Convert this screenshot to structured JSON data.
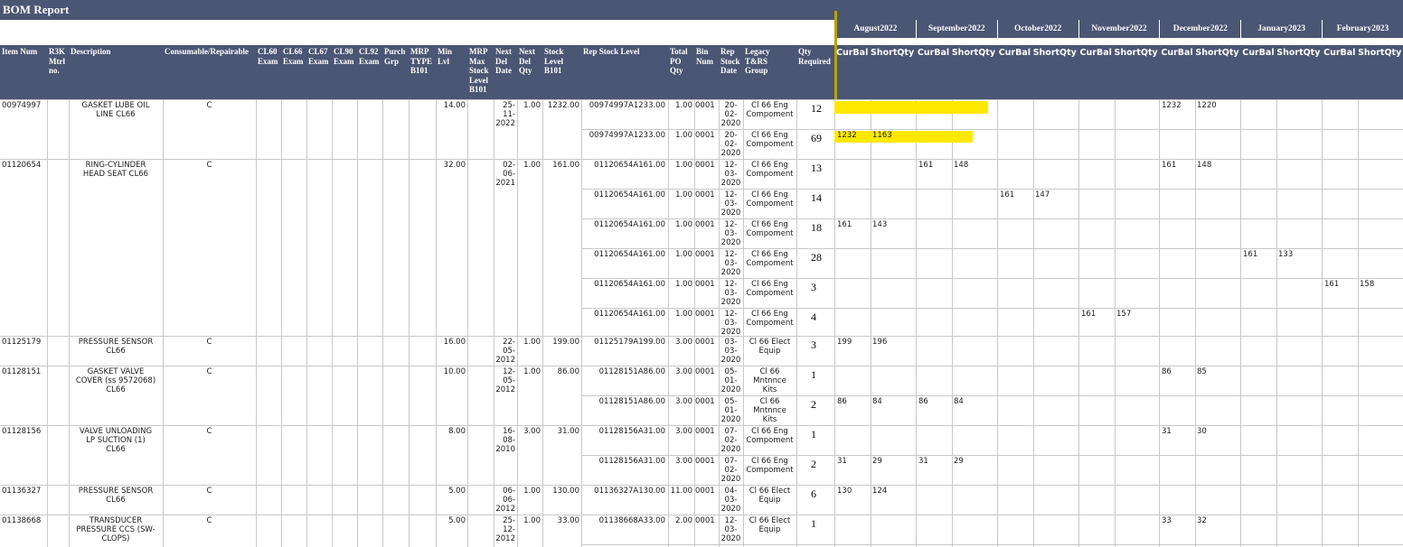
{
  "report_title": "BOM Report",
  "months": [
    "August2022",
    "September2022",
    "October2022",
    "November2022",
    "December2022",
    "January2023",
    "February2023"
  ],
  "headers": {
    "item_num": "Item Num",
    "r3k": [
      "R3K",
      "Mtrl",
      "no."
    ],
    "description": "Description",
    "consumable": "Consumable/Repairable",
    "cl60": [
      "CL60",
      "Exam"
    ],
    "cl66": [
      "CL66",
      "Exam"
    ],
    "cl67": [
      "CL67",
      "Exam"
    ],
    "cl90": [
      "CL90",
      "Exam"
    ],
    "cl92": [
      "CL92",
      "Exam"
    ],
    "purch": [
      "Purch",
      "Grp"
    ],
    "mrp_type": [
      "MRP",
      "TYPE",
      "B101"
    ],
    "min_lvl": [
      "Min",
      "Lvl"
    ],
    "mrp_max": [
      "MRP",
      "Max",
      "Stock",
      "Level",
      "B101"
    ],
    "next_del_date": [
      "Next",
      "Del",
      "Date"
    ],
    "next_del_qty": [
      "Next",
      "Del",
      "Qty"
    ],
    "stock_level": [
      "Stock",
      "Level",
      "B101"
    ],
    "rep_stock_level": "Rep Stock Level",
    "total_po_qty": [
      "Total",
      "PO",
      "Qty"
    ],
    "bin_num": [
      "Bin",
      "Num"
    ],
    "rep_stock_date": [
      "Rep",
      "Stock",
      "Date"
    ],
    "legacy": [
      "Legacy",
      "T&RS",
      "Group"
    ],
    "qty_required": [
      "Qty",
      "Required"
    ],
    "curbal": "CurBal",
    "shortqty": "ShortQty"
  },
  "items": [
    {
      "item": "00974997",
      "desc": [
        "GASKET LUBE OIL",
        "LINE CL66"
      ],
      "cons": "C",
      "min": "14.00",
      "nd_date": [
        "25-",
        "11-",
        "2022"
      ],
      "nd_qty": "1.00",
      "stock": "1232.00"
    },
    {
      "item": "01120654",
      "desc": [
        "RING-CYLINDER",
        "HEAD SEAT CL66"
      ],
      "cons": "C",
      "min": "32.00",
      "nd_date": [
        "02-",
        "06-",
        "2021"
      ],
      "nd_qty": "1.00",
      "stock": "161.00"
    },
    {
      "item": "01125179",
      "desc": [
        "PRESSURE SENSOR",
        "CL66"
      ],
      "cons": "C",
      "min": "16.00",
      "nd_date": [
        "22-",
        "05-",
        "2012"
      ],
      "nd_qty": "1.00",
      "stock": "199.00"
    },
    {
      "item": "01128151",
      "desc": [
        "GASKET VALVE",
        "COVER (ss 9572068)",
        "CL66"
      ],
      "cons": "C",
      "min": "10.00",
      "nd_date": [
        "12-",
        "05-",
        "2012"
      ],
      "nd_qty": "1.00",
      "stock": "86.00"
    },
    {
      "item": "01128156",
      "desc": [
        "VALVE UNLOADING",
        "LP SUCTION (1)",
        "CL66"
      ],
      "cons": "C",
      "min": "8.00",
      "nd_date": [
        "16-",
        "08-",
        "2010"
      ],
      "nd_qty": "3.00",
      "stock": "31.00"
    },
    {
      "item": "01136327",
      "desc": [
        "PRESSURE SENSOR",
        "CL66"
      ],
      "cons": "C",
      "min": "5.00",
      "nd_date": [
        "06-",
        "06-",
        "2012"
      ],
      "nd_qty": "1.00",
      "stock": "130.00"
    },
    {
      "item": "01138668",
      "desc": [
        "TRANSDUCER",
        "PRESSURE CCS (SW-",
        "CLOPS)"
      ],
      "cons": "C",
      "min": "5.00",
      "nd_date": [
        "25-",
        "12-",
        "2012"
      ],
      "nd_qty": "1.00",
      "stock": "33.00"
    }
  ],
  "subrows": [
    {
      "rep": "00974997A1233.00",
      "po": "1.00",
      "bin": "0001",
      "date": [
        "20-",
        "02-",
        "2020"
      ],
      "legacy": [
        "Cl 66 Eng",
        "Compoment"
      ],
      "qty": "12"
    },
    {
      "rep": "00974997A1233.00",
      "po": "1.00",
      "bin": "0001",
      "date": [
        "20-",
        "02-",
        "2020"
      ],
      "legacy": [
        "Cl 66 Eng",
        "Compoment"
      ],
      "qty": "69"
    },
    {
      "rep": "01120654A161.00",
      "po": "1.00",
      "bin": "0001",
      "date": [
        "12-",
        "03-",
        "2020"
      ],
      "legacy": [
        "Cl 66 Eng",
        "Compoment"
      ],
      "qty": "13"
    },
    {
      "rep": "01120654A161.00",
      "po": "1.00",
      "bin": "0001",
      "date": [
        "12-",
        "03-",
        "2020"
      ],
      "legacy": [
        "Cl 66 Eng",
        "Compoment"
      ],
      "qty": "14"
    },
    {
      "rep": "01120654A161.00",
      "po": "1.00",
      "bin": "0001",
      "date": [
        "12-",
        "03-",
        "2020"
      ],
      "legacy": [
        "Cl 66 Eng",
        "Compoment"
      ],
      "qty": "18"
    },
    {
      "rep": "01120654A161.00",
      "po": "1.00",
      "bin": "0001",
      "date": [
        "12-",
        "03-",
        "2020"
      ],
      "legacy": [
        "Cl 66 Eng",
        "Compoment"
      ],
      "qty": "28"
    },
    {
      "rep": "01120654A161.00",
      "po": "1.00",
      "bin": "0001",
      "date": [
        "12-",
        "03-",
        "2020"
      ],
      "legacy": [
        "Cl 66 Eng",
        "Compoment"
      ],
      "qty": "3"
    },
    {
      "rep": "01120654A161.00",
      "po": "1.00",
      "bin": "0001",
      "date": [
        "12-",
        "03-",
        "2020"
      ],
      "legacy": [
        "Cl 66 Eng",
        "Compoment"
      ],
      "qty": "4"
    },
    {
      "rep": "01125179A199.00",
      "po": "3.00",
      "bin": "0001",
      "date": [
        "03-",
        "03-",
        "2020"
      ],
      "legacy": [
        "Cl 66 Elect",
        "Equip"
      ],
      "qty": "3"
    },
    {
      "rep": "01128151A86.00",
      "po": "3.00",
      "bin": "0001",
      "date": [
        "05-",
        "01-",
        "2020"
      ],
      "legacy": [
        "Cl 66",
        "Mntnnce",
        "Kits"
      ],
      "qty": "1"
    },
    {
      "rep": "01128151A86.00",
      "po": "3.00",
      "bin": "0001",
      "date": [
        "05-",
        "01-",
        "2020"
      ],
      "legacy": [
        "Cl 66",
        "Mntnnce",
        "Kits"
      ],
      "qty": "2"
    },
    {
      "rep": "01128156A31.00",
      "po": "3.00",
      "bin": "0001",
      "date": [
        "07-",
        "02-",
        "2020"
      ],
      "legacy": [
        "Cl 66 Eng",
        "Compoment"
      ],
      "qty": "1"
    },
    {
      "rep": "01128156A31.00",
      "po": "3.00",
      "bin": "0001",
      "date": [
        "07-",
        "02-",
        "2020"
      ],
      "legacy": [
        "Cl 66 Eng",
        "Compoment"
      ],
      "qty": "2"
    },
    {
      "rep": "01136327A130.00",
      "po": "11.00",
      "bin": "0001",
      "date": [
        "04-",
        "03-",
        "2020"
      ],
      "legacy": [
        "Cl 66 Elect",
        "Equip"
      ],
      "qty": "6"
    },
    {
      "rep": "01138668A33.00",
      "po": "2.00",
      "bin": "0001",
      "date": [
        "12-",
        "03-",
        "2020"
      ],
      "legacy": [
        "Cl 66 Elect",
        "Equip"
      ],
      "qty": "1"
    }
  ],
  "month_values": [
    [
      null,
      null,
      null,
      null,
      [
        "1232",
        "1220"
      ],
      null,
      null
    ],
    [
      [
        "1232",
        "1163"
      ],
      null,
      null,
      null,
      null,
      null,
      null
    ],
    [
      null,
      [
        "161",
        "148"
      ],
      null,
      null,
      [
        "161",
        "148"
      ],
      null,
      null
    ],
    [
      null,
      null,
      [
        "161",
        "147"
      ],
      null,
      null,
      null,
      null
    ],
    [
      [
        "161",
        "143"
      ],
      null,
      null,
      null,
      null,
      null,
      null
    ],
    [
      null,
      null,
      null,
      null,
      null,
      [
        "161",
        "133"
      ],
      null
    ],
    [
      null,
      null,
      null,
      null,
      null,
      null,
      [
        "161",
        "158"
      ]
    ],
    [
      null,
      null,
      null,
      [
        "161",
        "157"
      ],
      null,
      null,
      null
    ],
    [
      [
        "199",
        "196"
      ],
      null,
      null,
      null,
      null,
      null,
      null
    ],
    [
      null,
      null,
      null,
      null,
      [
        "86",
        "85"
      ],
      null,
      null
    ],
    [
      [
        "86",
        "84"
      ],
      [
        "86",
        "84"
      ],
      null,
      null,
      null,
      null,
      null
    ],
    [
      null,
      null,
      null,
      null,
      [
        "31",
        "30"
      ],
      null,
      null
    ],
    [
      [
        "31",
        "29"
      ],
      [
        "31",
        "29"
      ],
      null,
      null,
      null,
      null,
      null
    ],
    [
      [
        "130",
        "124"
      ],
      null,
      null,
      null,
      null,
      null,
      null
    ],
    [
      null,
      null,
      null,
      null,
      [
        "33",
        "32"
      ],
      null,
      null
    ]
  ],
  "colors": {
    "header_bg": "#4a5673",
    "highlight": "#ffe800",
    "grid": "#c9c9c9"
  }
}
